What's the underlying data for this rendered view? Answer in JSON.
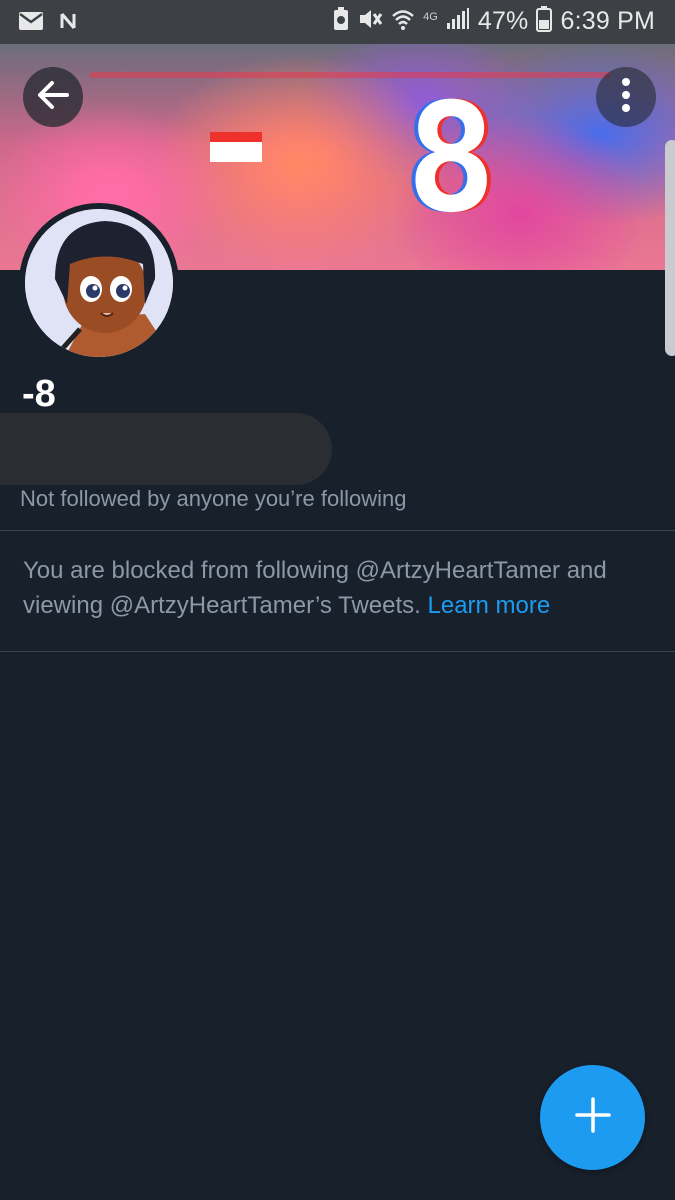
{
  "status_bar": {
    "battery_percent": "47%",
    "time": "6:39 PM",
    "network": "4G",
    "icons": [
      "mail-icon",
      "nfc-icon",
      "battery-saver-icon",
      "vibrate-mute-icon",
      "wifi-icon",
      "signal-icon",
      "battery-icon"
    ]
  },
  "header": {
    "back_icon": "arrow-left-icon",
    "more_icon": "more-vertical-icon"
  },
  "banner": {
    "score_text": "8"
  },
  "profile": {
    "display_name": "-8",
    "followers_note": "Not followed by anyone you’re following"
  },
  "blocked": {
    "message": "You are blocked from following @ArtzyHeartTamer and viewing @ArtzyHeartTamer’s Tweets.",
    "learn_more": "Learn more"
  },
  "fab": {
    "icon": "plus-icon"
  },
  "colors": {
    "background": "#17202b",
    "accent": "#1d9bf0",
    "muted_text": "#8b98a5",
    "divider": "#38444d"
  }
}
